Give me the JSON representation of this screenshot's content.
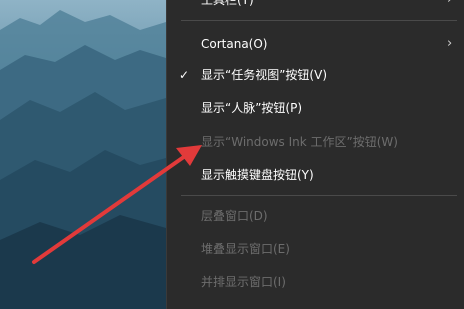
{
  "menu": {
    "items": [
      {
        "label": "工具栏(T)",
        "enabled": true
      },
      {
        "label": "Cortana(O)",
        "enabled": true,
        "submenu": true,
        "submenu_icon": "chevron-right-icon"
      },
      {
        "label": "显示“任务视图”按钮(V)",
        "enabled": true,
        "checked": true,
        "check_icon": "checkmark-icon"
      },
      {
        "label": "显示“人脉”按钮(P)",
        "enabled": true
      },
      {
        "label": "显示“Windows Ink 工作区”按钮(W)",
        "enabled": false
      },
      {
        "label": "显示触摸键盘按钮(Y)",
        "enabled": true
      },
      {
        "label": "层叠窗口(D)",
        "enabled": false
      },
      {
        "label": "堆叠显示窗口(E)",
        "enabled": false
      },
      {
        "label": "并排显示窗口(I)",
        "enabled": false
      }
    ]
  },
  "colors": {
    "menu_bg": "#2b2b2b",
    "text": "#ffffff",
    "disabled_text": "#6d6d6d",
    "annotation_arrow": "#e23a3a"
  }
}
